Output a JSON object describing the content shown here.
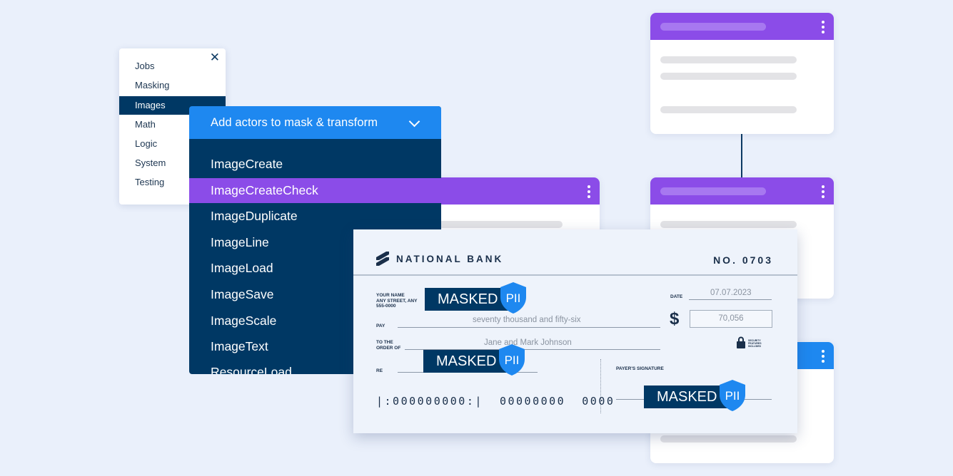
{
  "menu": {
    "close_icon": "close-icon",
    "items": [
      "Jobs",
      "Masking",
      "Images",
      "Math",
      "Logic",
      "System",
      "Testing"
    ],
    "active_index": 2
  },
  "dropdown": {
    "title": "Add actors to mask & transform",
    "chevron_icon": "chevron-down-icon",
    "items": [
      "ImageCreate",
      "ImageCreateCheck",
      "ImageDuplicate",
      "ImageLine",
      "ImageLoad",
      "ImageSave",
      "ImageScale",
      "ImageText",
      "ResourceLoad"
    ],
    "selected_index": 1
  },
  "check": {
    "bank_name": "NATIONAL BANK",
    "number": "NO. 0703",
    "name_label": "YOUR NAME\nANY STREET, ANY\n555-0000",
    "date_label": "DATE",
    "date_value": "07.07.2023",
    "pay_label": "PAY",
    "pay_words": "seventy thousand and fifty-six",
    "currency_symbol": "$",
    "amount": "70,056",
    "to_order_label": "TO THE\nORDER OF",
    "payee": "Jane and Mark Johnson",
    "re_label": "RE",
    "security_label": "SECURITY\nFEATURES\nINCLUDED",
    "signature_label": "PAYER'S SIGNATURE",
    "micr_line": "|:000000000:|  00000000  0000",
    "mask_text": "MASKED",
    "pii_badge": "PII"
  },
  "colors": {
    "navy": "#003864",
    "purple": "#8b4ce8",
    "blue": "#1e88f0",
    "background": "#eaf0fb"
  }
}
